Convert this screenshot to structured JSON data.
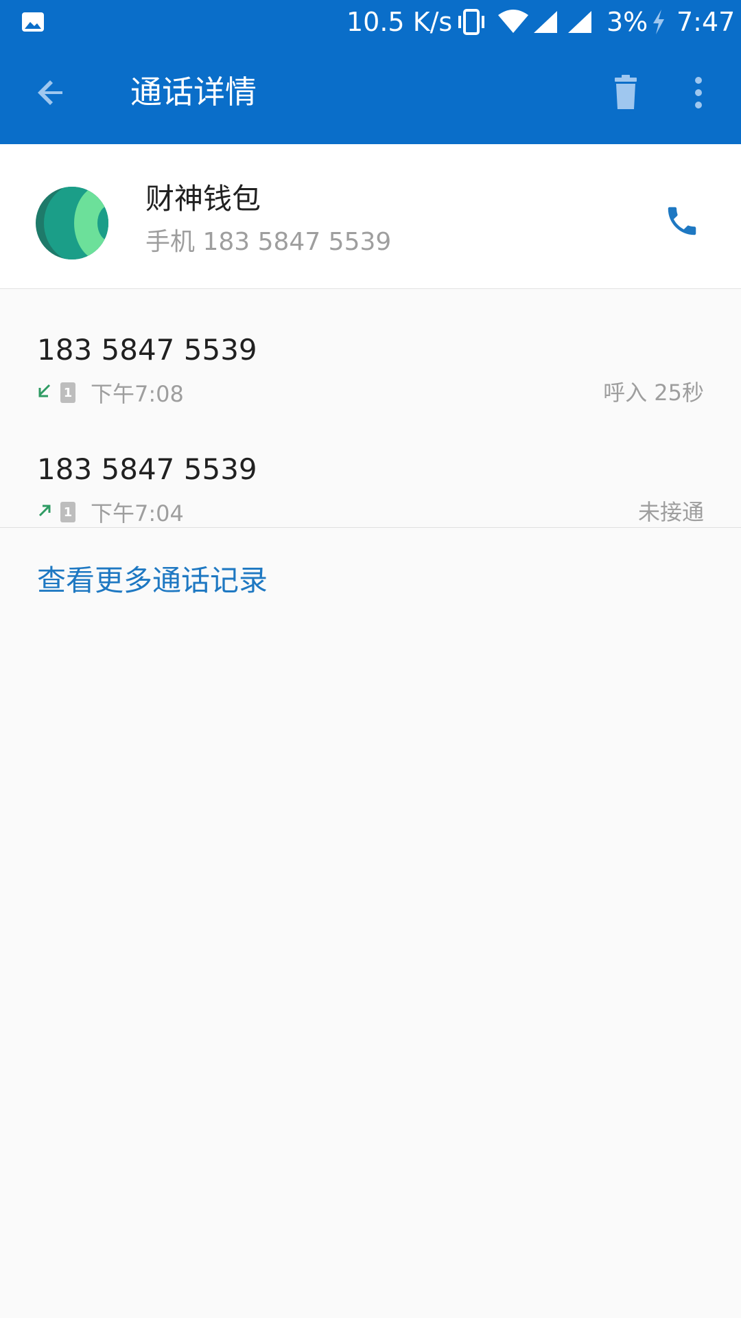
{
  "status_bar": {
    "network_speed": "10.5 K/s",
    "battery": "3%",
    "time": "7:47",
    "icons": [
      "image-notification-icon",
      "vibrate-icon",
      "wifi-icon",
      "signal-icon",
      "signal-icon-2",
      "charging-icon"
    ]
  },
  "toolbar": {
    "title": "通话详情",
    "back_icon": "arrow-back-icon",
    "delete_icon": "trash-icon",
    "more_icon": "more-vert-icon",
    "color": "#0a6ec9"
  },
  "contact": {
    "name": "财神钱包",
    "subtitle": "手机 183 5847 5539",
    "call_icon": "phone-icon",
    "accent": "#1e78c2"
  },
  "calls": [
    {
      "number": "183 5847 5539",
      "direction_icon": "incoming-call-icon",
      "sim": "1",
      "time": "下午7:08",
      "status": "呼入 25秒"
    },
    {
      "number": "183 5847 5539",
      "direction_icon": "outgoing-call-icon",
      "sim": "1",
      "time": "下午7:04",
      "status": "未接通"
    }
  ],
  "more_link": "查看更多通话记录"
}
